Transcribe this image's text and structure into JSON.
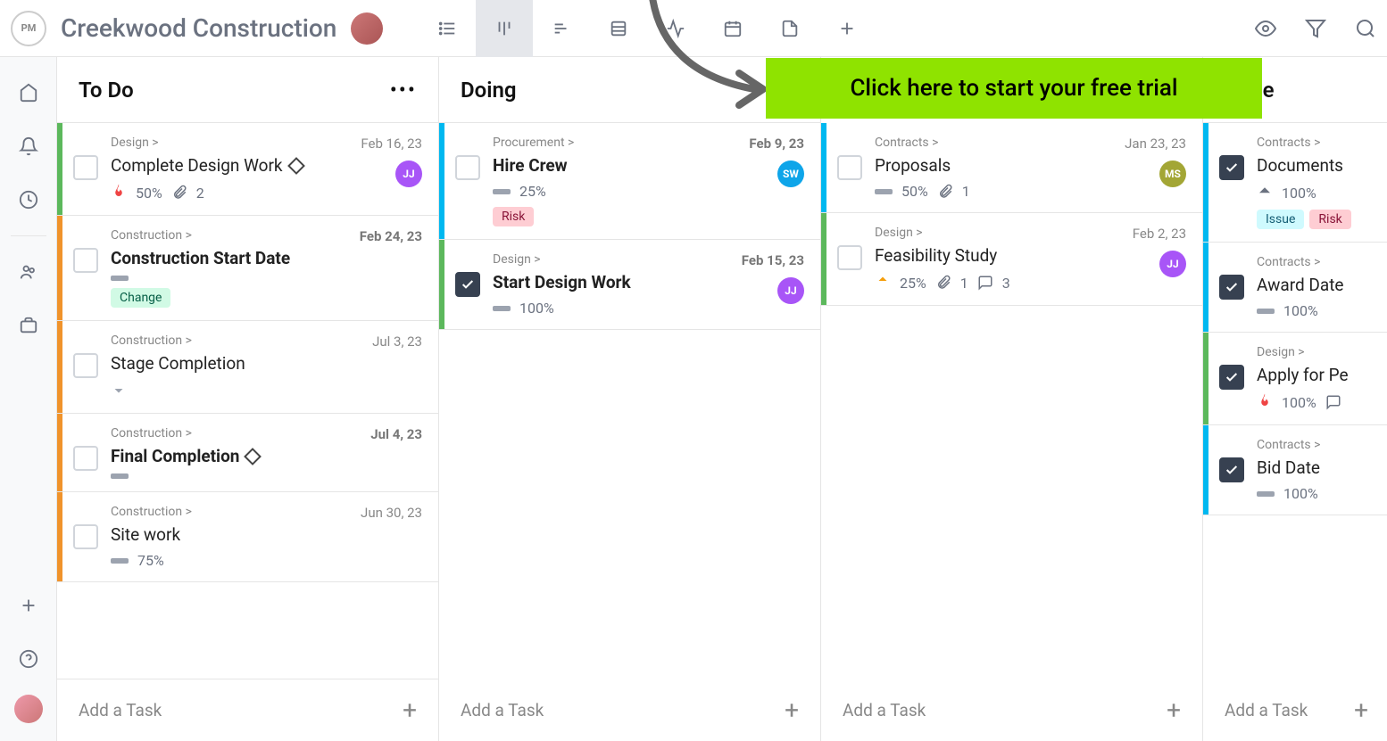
{
  "header": {
    "logo_text": "PM",
    "project_title": "Creekwood Construction"
  },
  "cta": {
    "banner_text": "Click here to start your free trial"
  },
  "columns": [
    {
      "title": "To Do",
      "show_menu": true,
      "add_task_label": "Add a Task",
      "cards": [
        {
          "stripe": "green",
          "breadcrumb": "Design >",
          "title": "Complete Design Work",
          "milestone": true,
          "date": "Feb 16, 23",
          "priority": "flame",
          "progress": "50%",
          "attach": "2",
          "avatar": {
            "text": "JJ",
            "cls": "av-purple"
          }
        },
        {
          "stripe": "orange",
          "breadcrumb": "Construction >",
          "title": "Construction Start Date",
          "bold": true,
          "date": "Feb 24, 23",
          "date_bold": true,
          "priority": "bar",
          "tags": [
            "Change"
          ]
        },
        {
          "stripe": "orange",
          "breadcrumb": "Construction >",
          "title": "Stage Completion",
          "date": "Jul 3, 23",
          "priority": "arrow-down"
        },
        {
          "stripe": "orange",
          "breadcrumb": "Construction >",
          "title": "Final Completion",
          "bold": true,
          "milestone": true,
          "date": "Jul 4, 23",
          "date_bold": true,
          "priority": "bar"
        },
        {
          "stripe": "orange",
          "breadcrumb": "Construction >",
          "title": "Site work",
          "date": "Jun 30, 23",
          "priority": "bar",
          "progress": "75%"
        }
      ]
    },
    {
      "title": "Doing",
      "add_task_label": "Add a Task",
      "cards": [
        {
          "stripe": "blue",
          "breadcrumb": "Procurement >",
          "title": "Hire Crew",
          "bold": true,
          "date": "Feb 9, 23",
          "date_bold": true,
          "priority": "bar",
          "progress": "25%",
          "avatar": {
            "text": "SW",
            "cls": "av-blue"
          },
          "tags": [
            "Risk"
          ]
        },
        {
          "stripe": "green",
          "breadcrumb": "Design >",
          "title": "Start Design Work",
          "bold": true,
          "checked": true,
          "date": "Feb 15, 23",
          "date_bold": true,
          "priority": "bar",
          "progress": "100%",
          "avatar": {
            "text": "JJ",
            "cls": "av-purple"
          }
        }
      ]
    },
    {
      "title": "",
      "hidden_header": true,
      "add_task_label": "Add a Task",
      "cards": [
        {
          "stripe": "blue",
          "breadcrumb": "Contracts >",
          "title": "Proposals",
          "date": "Jan 23, 23",
          "priority": "bar",
          "progress": "50%",
          "attach": "1",
          "avatar": {
            "text": "MS",
            "cls": "av-olive"
          }
        },
        {
          "stripe": "green",
          "breadcrumb": "Design >",
          "title": "Feasibility Study",
          "date": "Feb 2, 23",
          "priority": "arrow-up-orange",
          "progress": "25%",
          "attach": "1",
          "comments": "3",
          "avatar": {
            "text": "JJ",
            "cls": "av-purple"
          }
        }
      ]
    },
    {
      "title": "Done",
      "narrow": true,
      "add_task_label": "Add a Task",
      "cards": [
        {
          "stripe": "blue",
          "breadcrumb": "Contracts >",
          "title": "Documents",
          "checked": true,
          "priority": "arrow-up-gray",
          "progress": "100%",
          "tags": [
            "Issue",
            "Risk"
          ]
        },
        {
          "stripe": "blue",
          "breadcrumb": "Contracts >",
          "title": "Award Date",
          "checked": true,
          "priority": "bar",
          "progress": "100%"
        },
        {
          "stripe": "green",
          "breadcrumb": "Design >",
          "title": "Apply for Pe",
          "checked": true,
          "priority": "flame",
          "progress": "100%",
          "comments": "?"
        },
        {
          "stripe": "blue",
          "breadcrumb": "Contracts >",
          "title": "Bid Date",
          "checked": true,
          "priority": "bar",
          "progress": "100%"
        }
      ]
    }
  ]
}
